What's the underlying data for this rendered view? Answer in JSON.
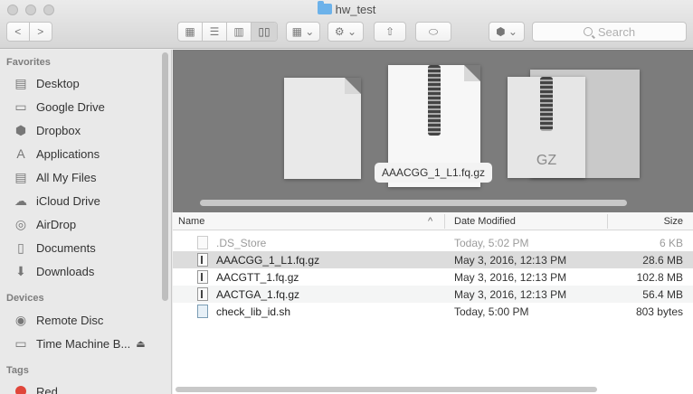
{
  "window": {
    "title": "hw_test"
  },
  "toolbar": {
    "back": "<",
    "forward": ">",
    "view_icons": "▦",
    "view_list": "☰",
    "view_columns": "▥",
    "view_coverflow": "▯▯",
    "arrange": "▦ ⌄",
    "action": "⚙ ⌄",
    "share": "⇧",
    "tags": "⬭",
    "dropbox": "⬢ ⌄",
    "search_placeholder": "Search"
  },
  "sidebar": {
    "favorites_header": "Favorites",
    "favorites": [
      {
        "label": "Desktop",
        "icon": "desktop-icon",
        "glyph": "▤"
      },
      {
        "label": "Google Drive",
        "icon": "folder-icon",
        "glyph": "▭"
      },
      {
        "label": "Dropbox",
        "icon": "dropbox-icon",
        "glyph": "⬢"
      },
      {
        "label": "Applications",
        "icon": "applications-icon",
        "glyph": "A"
      },
      {
        "label": "All My Files",
        "icon": "all-files-icon",
        "glyph": "▤"
      },
      {
        "label": "iCloud Drive",
        "icon": "cloud-icon",
        "glyph": "☁"
      },
      {
        "label": "AirDrop",
        "icon": "airdrop-icon",
        "glyph": "◎"
      },
      {
        "label": "Documents",
        "icon": "documents-icon",
        "glyph": "▯"
      },
      {
        "label": "Downloads",
        "icon": "downloads-icon",
        "glyph": "⬇"
      }
    ],
    "devices_header": "Devices",
    "devices": [
      {
        "label": "Remote Disc",
        "icon": "disc-icon",
        "glyph": "◉"
      },
      {
        "label": "Time Machine B...",
        "icon": "drive-icon",
        "glyph": "▭",
        "eject": "⏏"
      }
    ],
    "tags_header": "Tags",
    "tags": [
      {
        "label": "Red",
        "color": "#e0463a"
      }
    ]
  },
  "coverflow": {
    "caption": "AAACGG_1_L1.fq.gz",
    "gz_label": "GZ"
  },
  "list": {
    "columns": {
      "name": "Name",
      "sort": "^",
      "date": "Date Modified",
      "size": "Size"
    },
    "rows": [
      {
        "name": ".DS_Store",
        "date": "Today, 5:02 PM",
        "size": "6 KB"
      },
      {
        "name": "AAACGG_1_L1.fq.gz",
        "date": "May 3, 2016, 12:13 PM",
        "size": "28.6 MB"
      },
      {
        "name": "AACGTT_1.fq.gz",
        "date": "May 3, 2016, 12:13 PM",
        "size": "102.8 MB"
      },
      {
        "name": "AACTGA_1.fq.gz",
        "date": "May 3, 2016, 12:13 PM",
        "size": "56.4 MB"
      },
      {
        "name": "check_lib_id.sh",
        "date": "Today, 5:00 PM",
        "size": "803 bytes"
      }
    ]
  }
}
